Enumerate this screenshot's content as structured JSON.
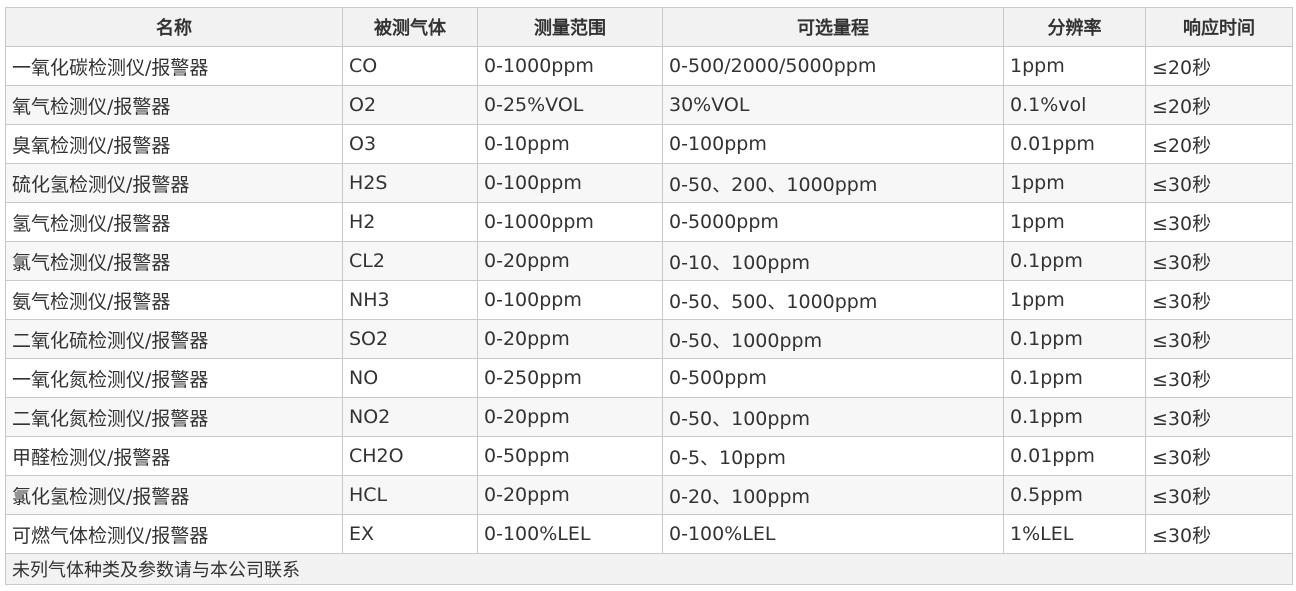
{
  "table": {
    "headers": [
      "名称",
      "被测气体",
      "测量范围",
      "可选量程",
      "分辨率",
      "响应时间"
    ],
    "rows": [
      [
        "一氧化碳检测仪/报警器",
        "CO",
        "0-1000ppm",
        "0-500/2000/5000ppm",
        "1ppm",
        "≤20秒"
      ],
      [
        "氧气检测仪/报警器",
        "O2",
        "0-25%VOL",
        "30%VOL",
        "0.1%vol",
        "≤20秒"
      ],
      [
        "臭氧检测仪/报警器",
        "O3",
        "0-10ppm",
        "0-100ppm",
        "0.01ppm",
        "≤20秒"
      ],
      [
        "硫化氢检测仪/报警器",
        "H2S",
        "0-100ppm",
        "0-50、200、1000ppm",
        "1ppm",
        "≤30秒"
      ],
      [
        "氢气检测仪/报警器",
        "H2",
        "0-1000ppm",
        "0-5000ppm",
        "1ppm",
        "≤30秒"
      ],
      [
        "氯气检测仪/报警器",
        "CL2",
        "0-20ppm",
        "0-10、100ppm",
        "0.1ppm",
        "≤30秒"
      ],
      [
        "氨气检测仪/报警器",
        "NH3",
        "0-100ppm",
        "0-50、500、1000ppm",
        "1ppm",
        "≤30秒"
      ],
      [
        "二氧化硫检测仪/报警器",
        "SO2",
        "0-20ppm",
        "0-50、1000ppm",
        "0.1ppm",
        "≤30秒"
      ],
      [
        "一氧化氮检测仪/报警器",
        "NO",
        "0-250ppm",
        "0-500ppm",
        "0.1ppm",
        "≤30秒"
      ],
      [
        "二氧化氮检测仪/报警器",
        "NO2",
        "0-20ppm",
        "0-50、100ppm",
        "0.1ppm",
        "≤30秒"
      ],
      [
        "甲醛检测仪/报警器",
        "CH2O",
        "0-50ppm",
        "0-5、10ppm",
        "0.01ppm",
        "≤30秒"
      ],
      [
        "氯化氢检测仪/报警器",
        "HCL",
        "0-20ppm",
        "0-20、100ppm",
        "0.5ppm",
        "≤30秒"
      ],
      [
        "可燃气体检测仪/报警器",
        "EX",
        "0-100%LEL",
        "0-100%LEL",
        "1%LEL",
        "≤30秒"
      ]
    ],
    "footer_note": "未列气体种类及参数请与本公司联系"
  },
  "colors": {
    "border": "#c8c8c8",
    "header_bg": "#f2f2f2",
    "stripe_bg": "#f7f7f7",
    "text": "#333333"
  }
}
